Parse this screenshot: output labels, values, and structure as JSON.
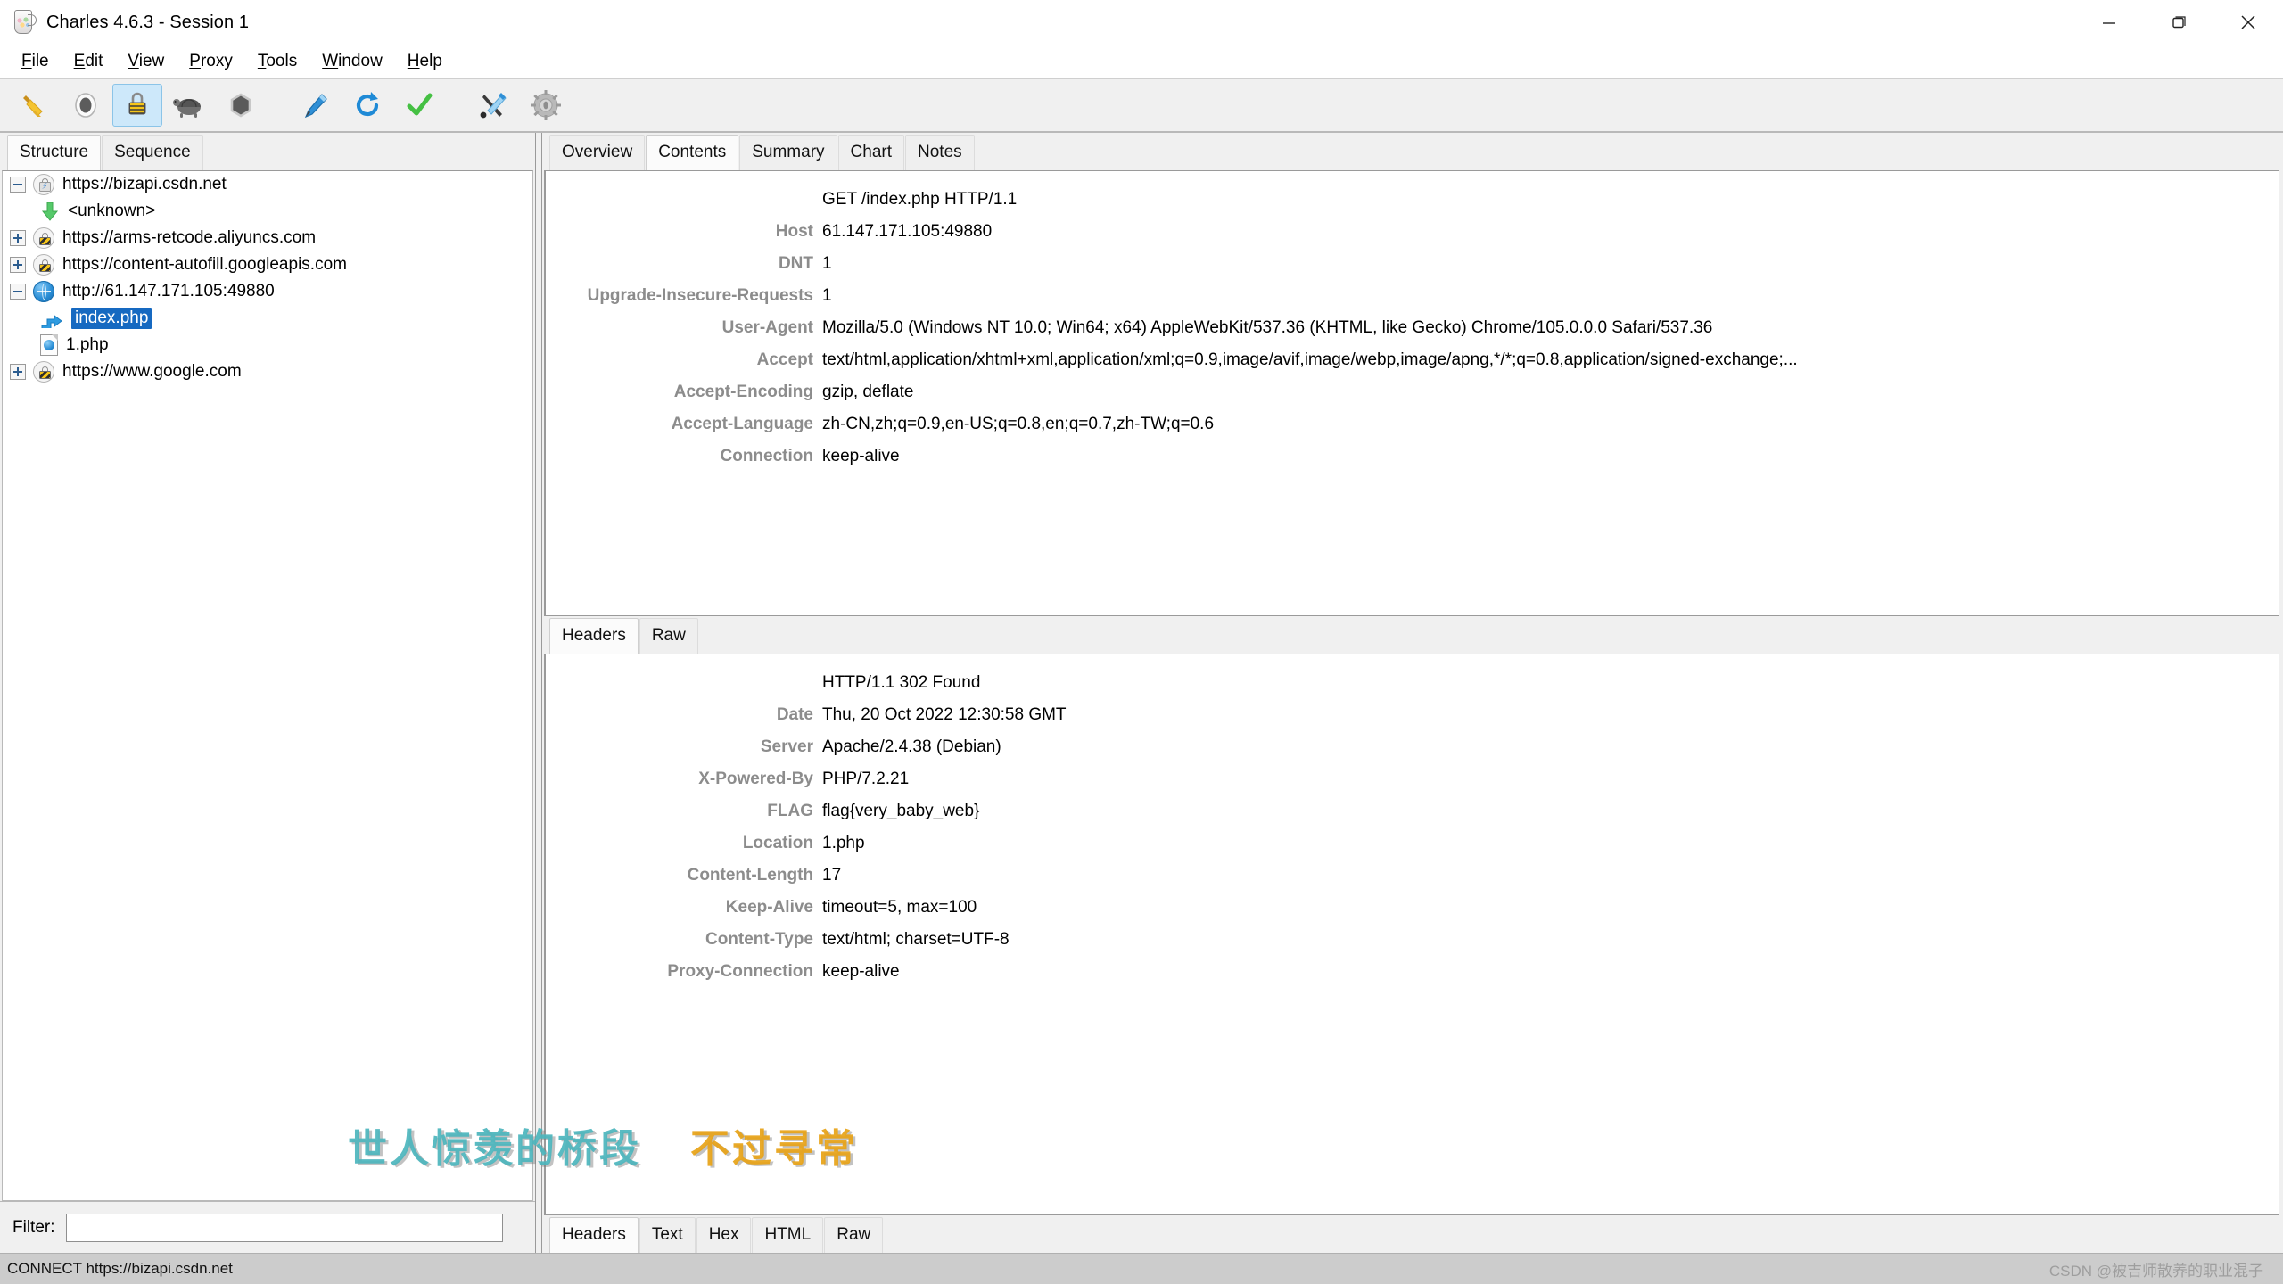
{
  "window": {
    "title": "Charles 4.6.3 - Session 1",
    "app_icon": "charles-jug-icon",
    "controls": {
      "minimize": "minimize-button",
      "maximize": "maximize-button",
      "close": "close-button"
    }
  },
  "menubar": {
    "items": [
      {
        "label": "File",
        "mnemonic": "F"
      },
      {
        "label": "Edit",
        "mnemonic": "E"
      },
      {
        "label": "View",
        "mnemonic": "V"
      },
      {
        "label": "Proxy",
        "mnemonic": "P"
      },
      {
        "label": "Tools",
        "mnemonic": "T"
      },
      {
        "label": "Window",
        "mnemonic": "W"
      },
      {
        "label": "Help",
        "mnemonic": "H"
      }
    ]
  },
  "toolbar": {
    "buttons": [
      {
        "name": "clear-session-icon",
        "selected": false
      },
      {
        "name": "record-icon",
        "selected": false
      },
      {
        "name": "ssl-proxying-icon",
        "selected": true
      },
      {
        "name": "throttle-turtle-icon",
        "selected": false
      },
      {
        "name": "breakpoints-icon",
        "selected": false
      },
      {
        "name": "compose-pen-icon",
        "selected": false
      },
      {
        "name": "repeat-icon",
        "selected": false
      },
      {
        "name": "validate-check-icon",
        "selected": false
      },
      {
        "name": "tools-icon",
        "selected": false
      },
      {
        "name": "settings-gear-icon",
        "selected": false
      }
    ]
  },
  "left_panel": {
    "tabs": [
      {
        "label": "Structure",
        "active": true
      },
      {
        "label": "Sequence",
        "active": false
      }
    ],
    "tree": [
      {
        "label": "https://bizapi.csdn.net",
        "icon": "lock-bolt-icon",
        "toggle": "minus",
        "indent": 0,
        "selected": false
      },
      {
        "label": "<unknown>",
        "icon": "green-down-arrow-icon",
        "toggle": "none",
        "indent": 1,
        "selected": false
      },
      {
        "label": "https://arms-retcode.aliyuncs.com",
        "icon": "lock-icon",
        "toggle": "plus",
        "indent": 0,
        "selected": false
      },
      {
        "label": "https://content-autofill.googleapis.com",
        "icon": "lock-icon",
        "toggle": "plus",
        "indent": 0,
        "selected": false
      },
      {
        "label": "http://61.147.171.105:49880",
        "icon": "globe-icon",
        "toggle": "minus",
        "indent": 0,
        "selected": false
      },
      {
        "label": "index.php",
        "icon": "redirect-arrow-icon",
        "toggle": "none",
        "indent": 1,
        "selected": true
      },
      {
        "label": "1.php",
        "icon": "page-icon",
        "toggle": "none",
        "indent": 1,
        "selected": false
      },
      {
        "label": "https://www.google.com",
        "icon": "lock-icon",
        "toggle": "plus",
        "indent": 0,
        "selected": false
      }
    ],
    "filter": {
      "label": "Filter:",
      "value": "",
      "placeholder": ""
    }
  },
  "right_panel": {
    "tabs": [
      {
        "label": "Overview",
        "active": false
      },
      {
        "label": "Contents",
        "active": true
      },
      {
        "label": "Summary",
        "active": false
      },
      {
        "label": "Chart",
        "active": false
      },
      {
        "label": "Notes",
        "active": false
      }
    ],
    "request": {
      "view_tabs": [
        {
          "label": "Headers",
          "active": true
        },
        {
          "label": "Raw",
          "active": false
        }
      ],
      "headers": [
        {
          "name": "",
          "value": "GET /index.php HTTP/1.1"
        },
        {
          "name": "Host",
          "value": "61.147.171.105:49880"
        },
        {
          "name": "DNT",
          "value": "1"
        },
        {
          "name": "Upgrade-Insecure-Requests",
          "value": "1"
        },
        {
          "name": "User-Agent",
          "value": "Mozilla/5.0 (Windows NT 10.0; Win64; x64) AppleWebKit/537.36 (KHTML, like Gecko) Chrome/105.0.0.0 Safari/537.36"
        },
        {
          "name": "Accept",
          "value": "text/html,application/xhtml+xml,application/xml;q=0.9,image/avif,image/webp,image/apng,*/*;q=0.8,application/signed-exchange;..."
        },
        {
          "name": "Accept-Encoding",
          "value": "gzip, deflate"
        },
        {
          "name": "Accept-Language",
          "value": "zh-CN,zh;q=0.9,en-US;q=0.8,en;q=0.7,zh-TW;q=0.6"
        },
        {
          "name": "Connection",
          "value": "keep-alive"
        }
      ]
    },
    "response": {
      "view_tabs": [
        {
          "label": "Headers",
          "active": true
        },
        {
          "label": "Text",
          "active": false
        },
        {
          "label": "Hex",
          "active": false
        },
        {
          "label": "HTML",
          "active": false
        },
        {
          "label": "Raw",
          "active": false
        }
      ],
      "headers": [
        {
          "name": "",
          "value": "HTTP/1.1 302 Found"
        },
        {
          "name": "Date",
          "value": "Thu, 20 Oct 2022 12:30:58 GMT"
        },
        {
          "name": "Server",
          "value": "Apache/2.4.38 (Debian)"
        },
        {
          "name": "X-Powered-By",
          "value": "PHP/7.2.21"
        },
        {
          "name": "FLAG",
          "value": "flag{very_baby_web}"
        },
        {
          "name": "Location",
          "value": "1.php"
        },
        {
          "name": "Content-Length",
          "value": "17"
        },
        {
          "name": "Keep-Alive",
          "value": "timeout=5, max=100"
        },
        {
          "name": "Content-Type",
          "value": "text/html; charset=UTF-8"
        },
        {
          "name": "Proxy-Connection",
          "value": "keep-alive"
        }
      ]
    }
  },
  "statusbar": {
    "text": "CONNECT https://bizapi.csdn.net",
    "watermark": "CSDN @被吉师散养的职业混子"
  },
  "overlay_watermark": {
    "part1": "世人惊羡的桥段",
    "part2": "不过寻常",
    "color1": "#4db6bd",
    "color2": "#e8a317"
  },
  "colors": {
    "selection": "#1669c1",
    "toolbar_selected": "#cde8fa",
    "header_name": "#8c8c8c",
    "statusbar_bg": "#cccccc"
  }
}
